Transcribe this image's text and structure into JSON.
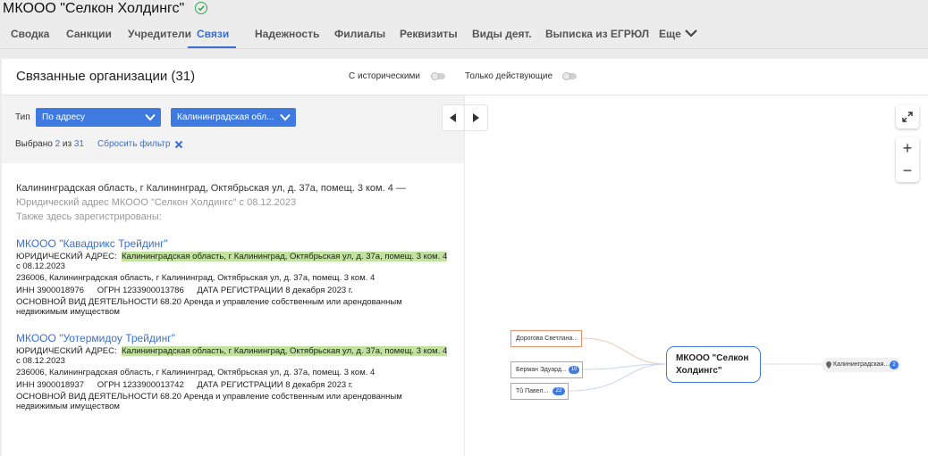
{
  "company": {
    "title": "МКООО \"Селкон Холдингс\""
  },
  "tabs": [
    "Сводка",
    "Санкции",
    "Учредители",
    "Связи",
    "Надежность",
    "Филиалы",
    "Реквизиты",
    "Виды деят.",
    "Выписка из ЕГРЮЛ",
    "Еще"
  ],
  "active_tab": "Связи",
  "section": {
    "title": "Связанные организации (31)",
    "toggle_historical": "С историческими",
    "toggle_active_only": "Только действующие"
  },
  "filters": {
    "type_label": "Тип",
    "type_value": "По адресу",
    "region_value": "Калининградская обл...",
    "selected_prefix": "Выбрано",
    "selected_count": "2",
    "selected_of": "из",
    "selected_total": "31",
    "reset_label": "Сбросить фильтр"
  },
  "address_block": {
    "address": "Калининградская область, г Калининград, Октябрьская ул, д. 37а, помещ. 3 ком. 4 —",
    "legal_note": "Юридический адрес МКООО \"Селкон Холдингс\" с 08.12.2023",
    "also_registered": "Также здесь зарегистрированы:"
  },
  "organizations": [
    {
      "name": "МКООО \"Кавадрикс Трейдинг\"",
      "legal_label": "ЮРИДИЧЕСКИЙ АДРЕС:",
      "legal_address": "Калининградская область, г Калининград, Октябрьская ул, д. 37а, помещ. 3 ком. 4",
      "legal_since": "с 08.12.2023",
      "postal_address": "236006, Калининградская область, г Калининград, Октябрьская ул, д. 37а, помещ. 3 ком. 4",
      "inn_label": "ИНН",
      "inn": "3900018976",
      "ogrn_label": "ОГРН",
      "ogrn": "1233900013786",
      "reg_label": "ДАТА РЕГИСТРАЦИИ",
      "reg_date": "8 декабря 2023 г.",
      "activity_label": "ОСНОВНОЙ ВИД ДЕЯТЕЛЬНОСТИ",
      "activity": "68.20 Аренда и управление собственным или арендованным недвижимым имуществом"
    },
    {
      "name": "МКООО \"Уотермидоу Трейдинг\"",
      "legal_label": "ЮРИДИЧЕСКИЙ АДРЕС:",
      "legal_address": "Калининградская область, г Калининград, Октябрьская ул, д. 37а, помещ. 3 ком. 4",
      "legal_since": "с 08.12.2023",
      "postal_address": "236006, Калининградская область, г Калининград, Октябрьская ул, д. 37а, помещ. 3 ком. 4",
      "inn_label": "ИНН",
      "inn": "3900018937",
      "ogrn_label": "ОГРН",
      "ogrn": "1233900013742",
      "reg_label": "ДАТА РЕГИСТРАЦИИ",
      "reg_date": "8 декабря 2023 г.",
      "activity_label": "ОСНОВНОЙ ВИД ДЕЯТЕЛЬНОСТИ",
      "activity": "68.20 Аренда и управление собственным или арендованным недвижимым имуществом"
    }
  ],
  "graph": {
    "center": "МКООО \"Селкон Холдингс\"",
    "people": [
      {
        "name": "Дорогова Светлана...",
        "count": ""
      },
      {
        "name": "Берман Эдуард...",
        "count": "10"
      },
      {
        "name": "Tů Павел...",
        "count": "22"
      }
    ],
    "region": {
      "name": "Калининградская...",
      "count": "2"
    }
  },
  "colors": {
    "accent": "#3870d6",
    "highlight": "#c2e3a0",
    "verified": "#2ea84a",
    "person_border": "#f0906a"
  }
}
